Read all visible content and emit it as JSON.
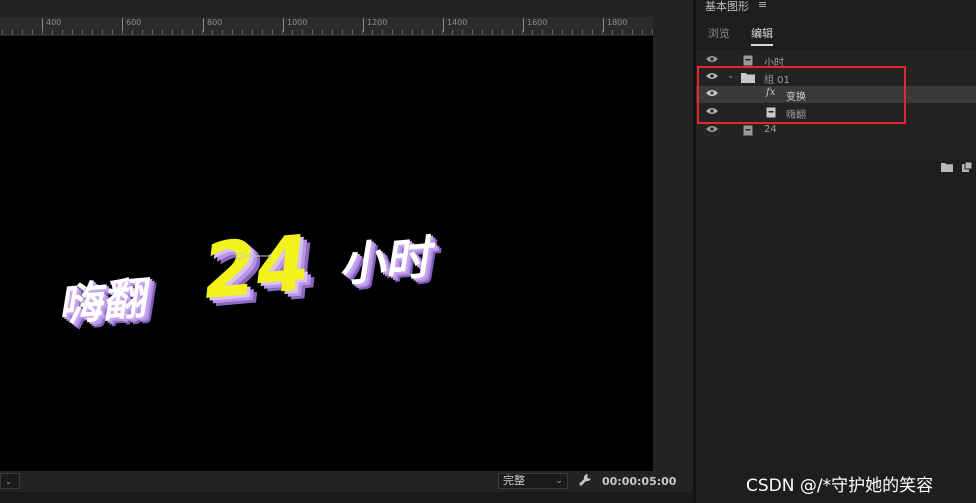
{
  "ruler": {
    "labels": [
      "400",
      "600",
      "800",
      "1000",
      "1200",
      "1400",
      "1600",
      "1800"
    ]
  },
  "canvas_title": {
    "word1": "嗨翻",
    "word2": "24",
    "word3": "小时"
  },
  "monitor": {
    "quality": "完整",
    "timecode": "00:00:05:00"
  },
  "panel": {
    "title": "基本图形",
    "menu_icon": "≡",
    "tabs": {
      "browse": "浏览",
      "edit": "编辑"
    },
    "layers": [
      {
        "label": "小时",
        "type": "text"
      },
      {
        "label": "组 01",
        "type": "group"
      },
      {
        "label": "变换",
        "type": "fx"
      },
      {
        "label": "嗨翻",
        "type": "text"
      },
      {
        "label": "24",
        "type": "text"
      }
    ]
  },
  "colors": {
    "highlight": "#e5262d",
    "title_yellow": "#f4f21c",
    "title_purple": "#b58fe6"
  },
  "watermark": "CSDN @/*守护她的笑容"
}
